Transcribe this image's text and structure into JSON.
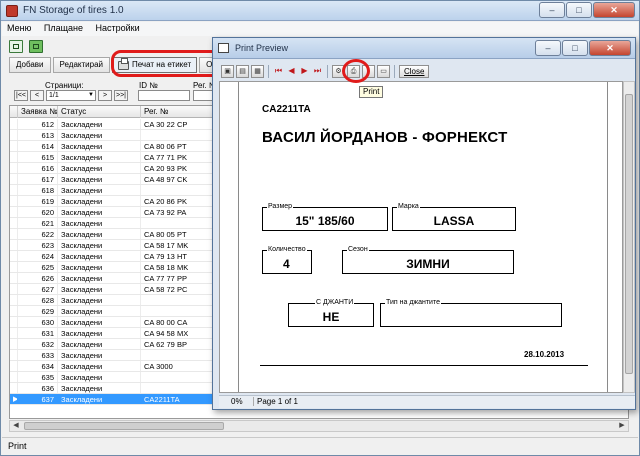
{
  "app": {
    "title": "FN Storage of tires 1.0"
  },
  "menu": [
    "Меню",
    "Плащане",
    "Настройки"
  ],
  "toolbar": {
    "add_label": "Добави",
    "edit_label": "Редактирай",
    "print_label_label": "Печат на етикет",
    "cut_label": "Опе"
  },
  "pager": {
    "label": "Страници:",
    "first": "|<<",
    "prev": "<",
    "page_value": "1/1",
    "next": ">",
    "last": ">>|",
    "id_label": "ID №",
    "reg_label": "Рег. №"
  },
  "grid": {
    "columns": [
      "Заявка №",
      "Статус",
      "Рег. №"
    ],
    "rows": [
      {
        "id": "612",
        "status": "Заскладени",
        "reg": "CA 30 22 CP"
      },
      {
        "id": "613",
        "status": "Заскладени",
        "reg": ""
      },
      {
        "id": "614",
        "status": "Заскладени",
        "reg": "CA 80 06 PT"
      },
      {
        "id": "615",
        "status": "Заскладени",
        "reg": "CA 77 71 PK"
      },
      {
        "id": "616",
        "status": "Заскладени",
        "reg": "CA 20 93 PK"
      },
      {
        "id": "617",
        "status": "Заскладени",
        "reg": "CA 48 97 CK"
      },
      {
        "id": "618",
        "status": "Заскладени",
        "reg": ""
      },
      {
        "id": "619",
        "status": "Заскладени",
        "reg": "CA 20 86 PK"
      },
      {
        "id": "620",
        "status": "Заскладени",
        "reg": "CA 73 92 PA"
      },
      {
        "id": "621",
        "status": "Заскладени",
        "reg": ""
      },
      {
        "id": "622",
        "status": "Заскладени",
        "reg": "CA 80 05 PT"
      },
      {
        "id": "623",
        "status": "Заскладени",
        "reg": "CA 58 17 MK"
      },
      {
        "id": "624",
        "status": "Заскладени",
        "reg": "CA 79 13 HT"
      },
      {
        "id": "625",
        "status": "Заскладени",
        "reg": "CA 58 18 MK"
      },
      {
        "id": "626",
        "status": "Заскладени",
        "reg": "CA 77 77 PP"
      },
      {
        "id": "627",
        "status": "Заскладени",
        "reg": "CA 58 72 PC"
      },
      {
        "id": "628",
        "status": "Заскладени",
        "reg": ""
      },
      {
        "id": "629",
        "status": "Заскладени",
        "reg": ""
      },
      {
        "id": "630",
        "status": "Заскладени",
        "reg": "CA 80 00 CA"
      },
      {
        "id": "631",
        "status": "Заскладени",
        "reg": "CA 94 58 MX"
      },
      {
        "id": "632",
        "status": "Заскладени",
        "reg": "CA 62 79 BP"
      },
      {
        "id": "633",
        "status": "Заскладени",
        "reg": ""
      },
      {
        "id": "634",
        "status": "Заскладени",
        "reg": "CA 3000"
      },
      {
        "id": "635",
        "status": "Заскладени",
        "reg": ""
      },
      {
        "id": "636",
        "status": "Заскладени",
        "reg": ""
      },
      {
        "id": "637",
        "status": "Заскладени",
        "reg": "CA2211TA",
        "selected": true
      }
    ],
    "ghost": {
      "date": "28.10.2013",
      "name": "ЙОРДАНОВ - ФОРНЕКСТ",
      "brand": "LASSA"
    }
  },
  "statusbar": {
    "text": "Print"
  },
  "preview": {
    "title": "Print Preview",
    "close_label": "Close",
    "tooltip": "Print",
    "zoom": "0%",
    "page_info": "Page 1 of 1",
    "label": {
      "code": "CA2211TA",
      "customer": "ВАСИЛ ЙОРДАНОВ - ФОРНЕКСТ",
      "size_caption": "Размер",
      "size_value": "15\" 185/60",
      "brand_caption": "Марка",
      "brand_value": "LASSA",
      "qty_caption": "Количество",
      "qty_value": "4",
      "season_caption": "Сезон",
      "season_value": "ЗИМНИ",
      "rims_caption": "С ДЖАНТИ",
      "rims_value": "НЕ",
      "rimtype_caption": "Тип на джантите",
      "rimtype_value": "",
      "date": "28.10.2013"
    }
  },
  "colors": {
    "selection": "#3399ff",
    "highlight_ring": "#e01b1b",
    "nav_arrows": "#c0171b"
  }
}
